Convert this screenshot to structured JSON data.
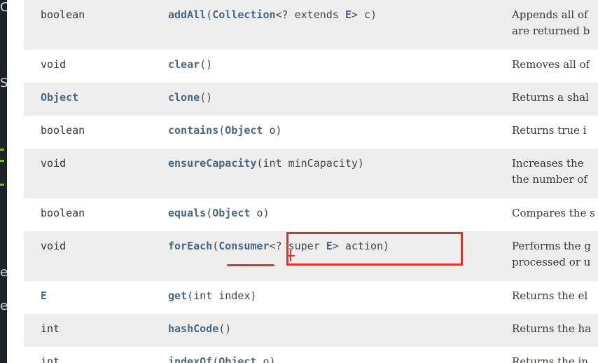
{
  "editor_strip": {
    "glyphs": [
      "C",
      "S",
      "e",
      "e"
    ]
  },
  "methods": [
    {
      "return_type": "boolean",
      "method_name": "addAll",
      "params_prefix": "(",
      "params_type": "Collection",
      "params_rest": "<? extends ",
      "params_type2": "E",
      "params_tail": "> c)",
      "desc_line1": "Appends all of",
      "desc_line2": "are returned b"
    },
    {
      "return_type": "void",
      "method_name": "clear",
      "params_tail": "()",
      "desc_line1": "Removes all of"
    },
    {
      "return_type": "Object",
      "method_name": "clone",
      "params_tail": "()",
      "desc_line1": "Returns a shal"
    },
    {
      "return_type": "boolean",
      "method_name": "contains",
      "params_prefix": "(",
      "params_type": "Object",
      "params_tail": " o)",
      "desc_line1": "Returns true i"
    },
    {
      "return_type": "void",
      "method_name": "ensureCapacity",
      "params_tail": "(int minCapacity)",
      "desc_line1": "Increases the",
      "desc_line2": "the number of"
    },
    {
      "return_type": "boolean",
      "method_name": "equals",
      "params_prefix": "(",
      "params_type": "Object",
      "params_tail": " o)",
      "desc_line1": "Compares the s"
    },
    {
      "return_type": "void",
      "method_name": "forEach",
      "params_prefix": "(",
      "params_type": "Consumer",
      "params_rest": "<? super ",
      "params_type2": "E",
      "params_tail": "> action)",
      "desc_line1": "Performs the g",
      "desc_line2": "processed or u"
    },
    {
      "return_type": "E",
      "method_name": "get",
      "params_tail": "(int index)",
      "desc_line1": "Returns the el"
    },
    {
      "return_type": "int",
      "method_name": "hashCode",
      "params_tail": "()",
      "desc_line1": "Returns the ha"
    },
    {
      "return_type": "int",
      "method_name": "indexOf",
      "params_prefix": "(",
      "params_type": "Object",
      "params_tail": " o)",
      "desc_line1": "Returns the in"
    }
  ],
  "colors": {
    "link": "#4a6782",
    "alt_row": "#eeeeef",
    "annotation": "#e0322d"
  }
}
